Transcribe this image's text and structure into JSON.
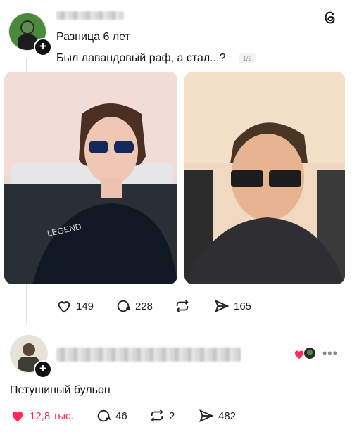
{
  "post1": {
    "title": "Разница 6 лет",
    "text": "Был лавандовый раф, а стал...?",
    "media_counter": "1/2",
    "actions": {
      "likes": "149",
      "comments": "228",
      "shares": "165"
    }
  },
  "post2": {
    "text": "Петушиный бульон",
    "actions": {
      "likes": "12,8 тыс.",
      "comments": "46",
      "reposts": "2",
      "shares": "482"
    }
  },
  "colors": {
    "like_active": "#ff2d55",
    "text": "#111111",
    "muted": "#999999"
  }
}
